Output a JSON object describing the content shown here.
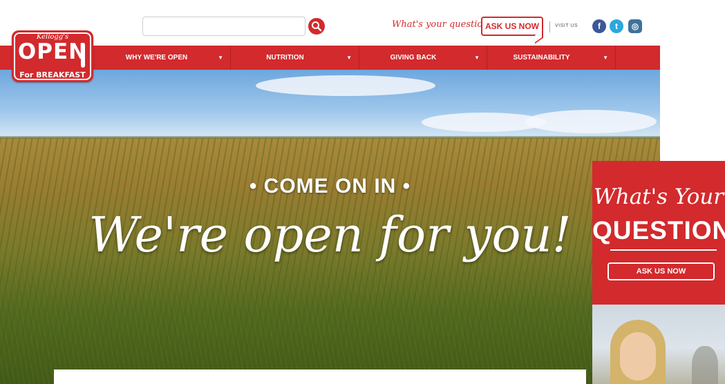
{
  "brand": {
    "logo_top": "Kellogg's",
    "logo_main": "OPEN",
    "logo_bottom": "For BREAKFAST"
  },
  "header": {
    "search": {
      "value": "",
      "placeholder": ""
    },
    "question_prompt": "What's your question?",
    "ask_button": "ASK US NOW",
    "visit_us": "VISIT US",
    "social": [
      {
        "icon": "facebook-icon",
        "glyph": "f"
      },
      {
        "icon": "twitter-icon",
        "glyph": "t"
      },
      {
        "icon": "instagram-icon",
        "glyph": "◎"
      }
    ]
  },
  "nav": {
    "items": [
      {
        "label": "WHY WE'RE OPEN",
        "arrow": "▼"
      },
      {
        "label": "NUTRITION",
        "arrow": "▼"
      },
      {
        "label": "GIVING BACK",
        "arrow": "▼"
      },
      {
        "label": "SUSTAINABILITY",
        "arrow": "▼"
      }
    ]
  },
  "hero": {
    "kicker": "• COME ON IN •",
    "headline": "We're open for you!"
  },
  "promo": {
    "title_line1": "What's Your",
    "title_line2": "QUESTION?",
    "button": "ASK US NOW"
  },
  "colors": {
    "brand_red": "#d22a2d",
    "facebook": "#3b5998",
    "twitter": "#2aa9e0",
    "instagram": "#3f729b"
  }
}
